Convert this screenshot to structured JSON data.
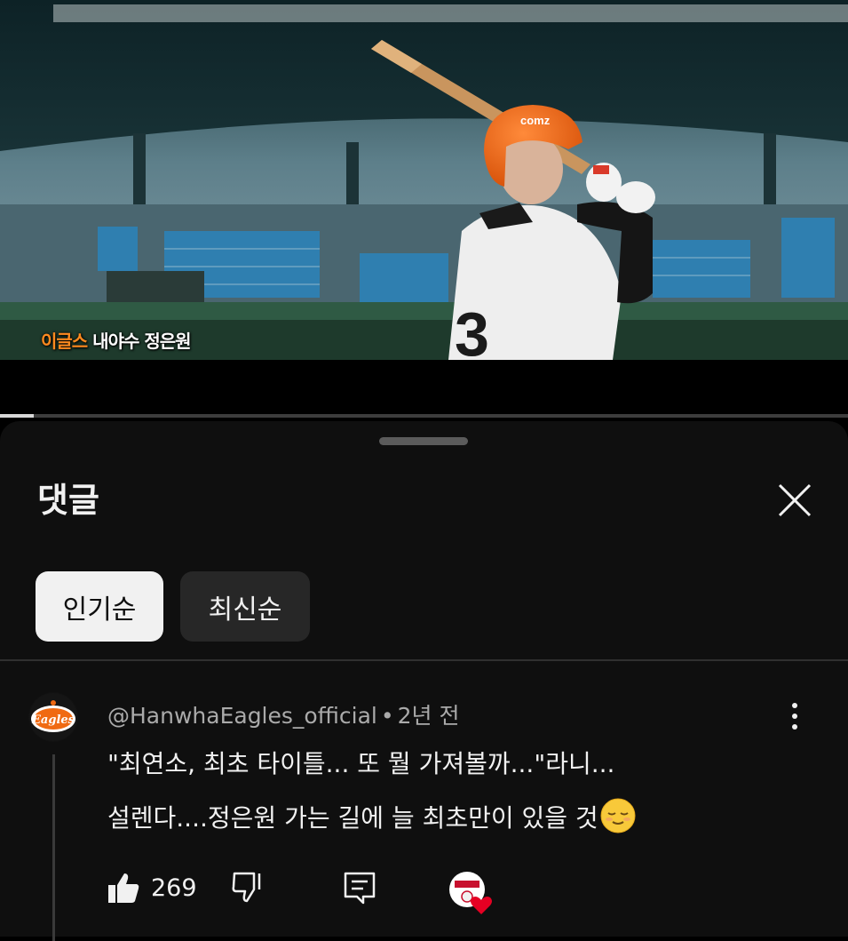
{
  "video": {
    "caption_accent": "이글스",
    "caption_rest": " 내야수 정은원",
    "progress_fraction": 0.04
  },
  "comments_sheet": {
    "title": "댓글",
    "sort_chips": [
      {
        "label": "인기순",
        "selected": true
      },
      {
        "label": "최신순",
        "selected": false
      }
    ],
    "comment": {
      "author": "@HanwhaEagles_official",
      "separator": "•",
      "time": "2년 전",
      "line1": "\"최연소, 최초 타이틀... 또 뭘 가져볼까...\"라니...",
      "line2": "설렌다....정은원 가는 길에 늘 최초만이 있을 것",
      "emoji": "relieved-face",
      "like_count": "269",
      "creator_hearted": true
    }
  },
  "colors": {
    "sheet_bg": "#0f0f0f",
    "chip_active_bg": "#f1f1f1",
    "chip_inactive_bg": "#272727",
    "caption_accent": "#ff8a1f",
    "heart": "#e60023",
    "helmet_orange": "#ff6a13"
  }
}
